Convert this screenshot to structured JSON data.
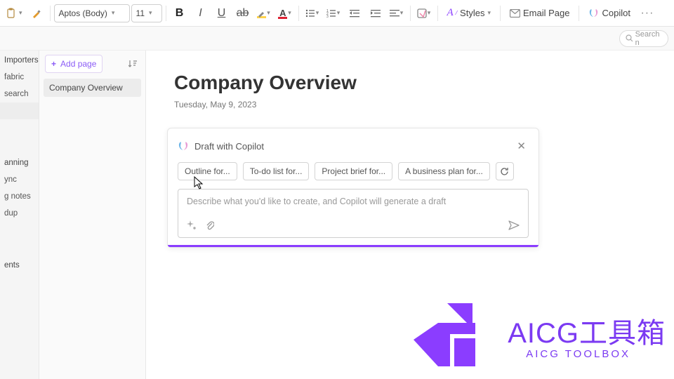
{
  "ribbon": {
    "font_family": "Aptos (Body)",
    "font_size": "11",
    "styles_label": "Styles",
    "email_label": "Email Page",
    "copilot_label": "Copilot"
  },
  "search": {
    "placeholder": "Search n"
  },
  "leftcol": {
    "head1": "Importers",
    "i1": "fabric",
    "i2": "search",
    "head2": "anning",
    "i3": "ync",
    "i4": "g notes",
    "i5": "dup",
    "head3": "ents"
  },
  "nav": {
    "addpage": "Add page",
    "page1": "Company Overview"
  },
  "page": {
    "title": "Company Overview",
    "date": "Tuesday, May 9, 2023"
  },
  "copilot": {
    "title": "Draft with Copilot",
    "chips": [
      "Outline for...",
      "To-do list for...",
      "Project brief for...",
      "A business plan for..."
    ],
    "placeholder": "Describe what you'd like to create, and Copilot will generate a draft"
  },
  "watermark": {
    "big": "AICG工具箱",
    "small": "AICG TOOLBOX"
  }
}
